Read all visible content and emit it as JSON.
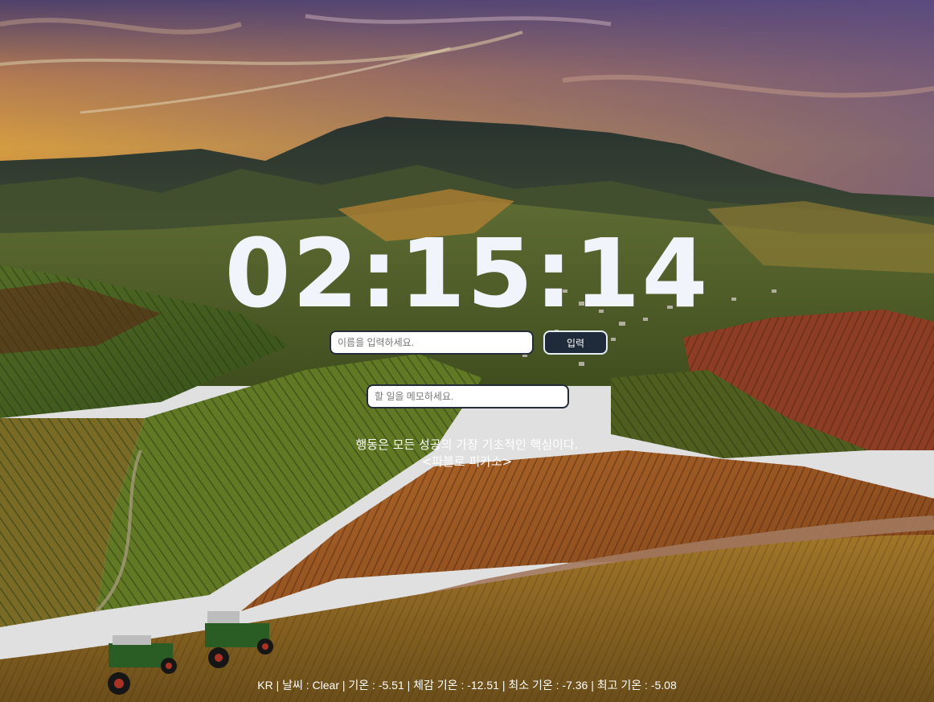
{
  "clock": {
    "time": "02:15:14"
  },
  "name_form": {
    "placeholder": "이름을 입력하세요.",
    "button_label": "입력"
  },
  "memo": {
    "placeholder": "할 일을 메모하세요."
  },
  "quote": {
    "text": "행동은 모든 성공의 가장 기초적인 핵심이다.",
    "author": "<파블로 피카소>"
  },
  "weather": {
    "line": "KR | 날씨 : Clear | 기온 : -5.51 | 체감 기온 : -12.51 | 최소 기온 : -7.36 | 최고 기온 : -5.08"
  }
}
